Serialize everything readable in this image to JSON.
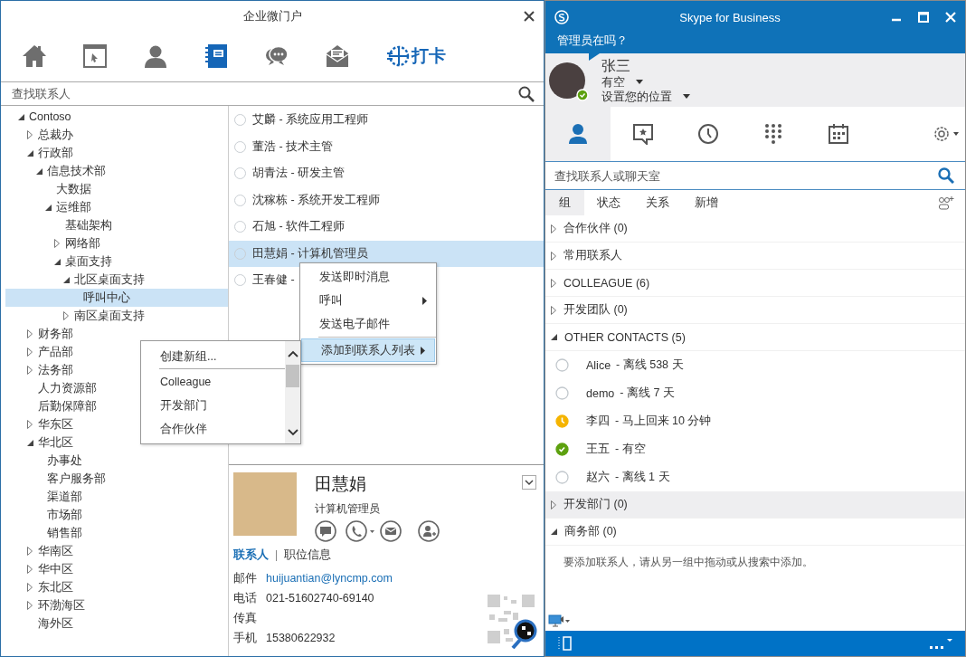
{
  "portal": {
    "window": {
      "title": "企业微门户"
    },
    "toolbar": [
      {
        "selected": false
      },
      {
        "selected": false
      },
      {
        "selected": false
      },
      {
        "selected": true
      },
      {
        "selected": false
      },
      {
        "selected": false
      },
      {
        "selected": false,
        "label": "打卡"
      }
    ],
    "search": {
      "placeholder": "查找联系人"
    },
    "tree": [
      {
        "label": "Contoso",
        "expanded": true,
        "selected": false,
        "children": [
          {
            "label": "总裁办",
            "expanded": false,
            "selected": false
          },
          {
            "label": "行政部",
            "expanded": true,
            "selected": false,
            "children": [
              {
                "label": "信息技术部",
                "expanded": true,
                "selected": false,
                "children": [
                  {
                    "label": "大数据",
                    "selected": false
                  },
                  {
                    "label": "运维部",
                    "expanded": true,
                    "selected": false,
                    "children": [
                      {
                        "label": "基础架构",
                        "selected": false
                      },
                      {
                        "label": "网络部",
                        "expanded": false,
                        "selected": false
                      },
                      {
                        "label": "桌面支持",
                        "expanded": true,
                        "selected": false,
                        "children": [
                          {
                            "label": "北区桌面支持",
                            "expanded": true,
                            "selected": false,
                            "children": [
                              {
                                "label": "呼叫中心",
                                "selected": true
                              }
                            ]
                          },
                          {
                            "label": "南区桌面支持",
                            "expanded": false,
                            "selected": false
                          }
                        ]
                      }
                    ]
                  }
                ]
              }
            ]
          },
          {
            "label": "财务部",
            "expanded": false,
            "selected": false
          },
          {
            "label": "产品部",
            "expanded": false,
            "selected": false
          },
          {
            "label": "法务部",
            "expanded": false,
            "selected": false
          },
          {
            "label": "人力资源部",
            "selected": false
          },
          {
            "label": "后勤保障部",
            "selected": false
          },
          {
            "label": "华东区",
            "expanded": false,
            "selected": false
          },
          {
            "label": "华北区",
            "expanded": true,
            "selected": false,
            "children": [
              {
                "label": "办事处",
                "selected": false
              },
              {
                "label": "客户服务部",
                "selected": false
              },
              {
                "label": "渠道部",
                "selected": false
              },
              {
                "label": "市场部",
                "selected": false
              },
              {
                "label": "销售部",
                "selected": false
              }
            ]
          },
          {
            "label": "华南区",
            "expanded": false,
            "selected": false
          },
          {
            "label": "华中区",
            "expanded": false,
            "selected": false
          },
          {
            "label": "东北区",
            "expanded": false,
            "selected": false
          },
          {
            "label": "环渤海区",
            "expanded": false,
            "selected": false
          },
          {
            "label": "海外区",
            "selected": false
          }
        ]
      }
    ],
    "contacts": [
      {
        "text": "艾麟 - 系统应用工程师",
        "selected": false
      },
      {
        "text": "董浩 - 技术主管",
        "selected": false
      },
      {
        "text": "胡青法 - 研发主管",
        "selected": false
      },
      {
        "text": "沈稼栋 - 系统开发工程师",
        "selected": false
      },
      {
        "text": "石旭 - 软件工程师",
        "selected": false
      },
      {
        "text": "田慧娟 - 计算机管理员",
        "selected": true
      },
      {
        "text": "王春健 -",
        "selected": false
      }
    ],
    "context_menu": [
      {
        "label": "发送即时消息",
        "submenu": false,
        "selected": false
      },
      {
        "label": "呼叫",
        "submenu": true,
        "selected": false
      },
      {
        "label": "发送电子邮件",
        "submenu": false,
        "selected": false
      },
      {
        "label": "添加到联系人列表",
        "submenu": true,
        "selected": true
      }
    ],
    "group_menu": {
      "items": [
        {
          "label": "创建新组...",
          "kind": "action"
        },
        {
          "label": "Colleague",
          "kind": "group"
        },
        {
          "label": "开发部门",
          "kind": "group"
        },
        {
          "label": "合作伙伴",
          "kind": "group"
        }
      ]
    },
    "card": {
      "name": "田慧娟",
      "title": "计算机管理员",
      "tabs": [
        {
          "label": "联系人",
          "selected": true
        },
        {
          "label": "职位信息",
          "selected": false
        }
      ],
      "fields": [
        {
          "label": "邮件",
          "value": "huijuantian@lyncmp.com",
          "kind": "link"
        },
        {
          "label": "电话",
          "value": "021-51602740-69140",
          "kind": "text"
        },
        {
          "label": "传真",
          "kind": "text"
        },
        {
          "label": "手机",
          "value": "15380622932",
          "kind": "text"
        }
      ]
    }
  },
  "skype": {
    "window": {
      "title": "Skype for Business"
    },
    "note": "管理员在吗？",
    "profile": {
      "name": "张三",
      "status": "有空",
      "color": "#5da10f",
      "location": "设置您的位置"
    },
    "nav": [
      {
        "selected": true
      },
      {
        "selected": false
      },
      {
        "selected": false
      },
      {
        "selected": false
      },
      {
        "selected": false
      }
    ],
    "search": {
      "placeholder": "查找联系人或聊天室"
    },
    "filters": [
      {
        "label": "组",
        "selected": true
      },
      {
        "label": "状态",
        "selected": false
      },
      {
        "label": "关系",
        "selected": false
      },
      {
        "label": "新增",
        "selected": false
      }
    ],
    "groups": [
      {
        "label": "合作伙伴 (0)",
        "expanded": false,
        "selected": false
      },
      {
        "label": "常用联系人",
        "expanded": false,
        "selected": false
      },
      {
        "label": "COLLEAGUE (6)",
        "expanded": false,
        "selected": false
      },
      {
        "label": "开发团队 (0)",
        "expanded": false,
        "selected": false
      },
      {
        "label": "OTHER CONTACTS (5)",
        "expanded": true,
        "selected": false,
        "contacts": [
          {
            "name": "Alice",
            "status_text": "- 离线 538 天",
            "kind": "offline"
          },
          {
            "name": "demo",
            "status_text": "- 离线 7 天",
            "kind": "offline"
          },
          {
            "name": "李四",
            "status_text": "- 马上回来 10 分钟",
            "kind": "away"
          },
          {
            "name": "王五",
            "status_text": "- 有空",
            "kind": "available"
          },
          {
            "name": "赵六",
            "status_text": "- 离线 1 天",
            "kind": "offline"
          }
        ]
      },
      {
        "label": "开发部门 (0)",
        "expanded": false,
        "selected": true
      },
      {
        "label": "商务部 (0)",
        "expanded": true,
        "selected": false,
        "hint": "要添加联系人，请从另一组中拖动或从搜索中添加。"
      }
    ]
  }
}
